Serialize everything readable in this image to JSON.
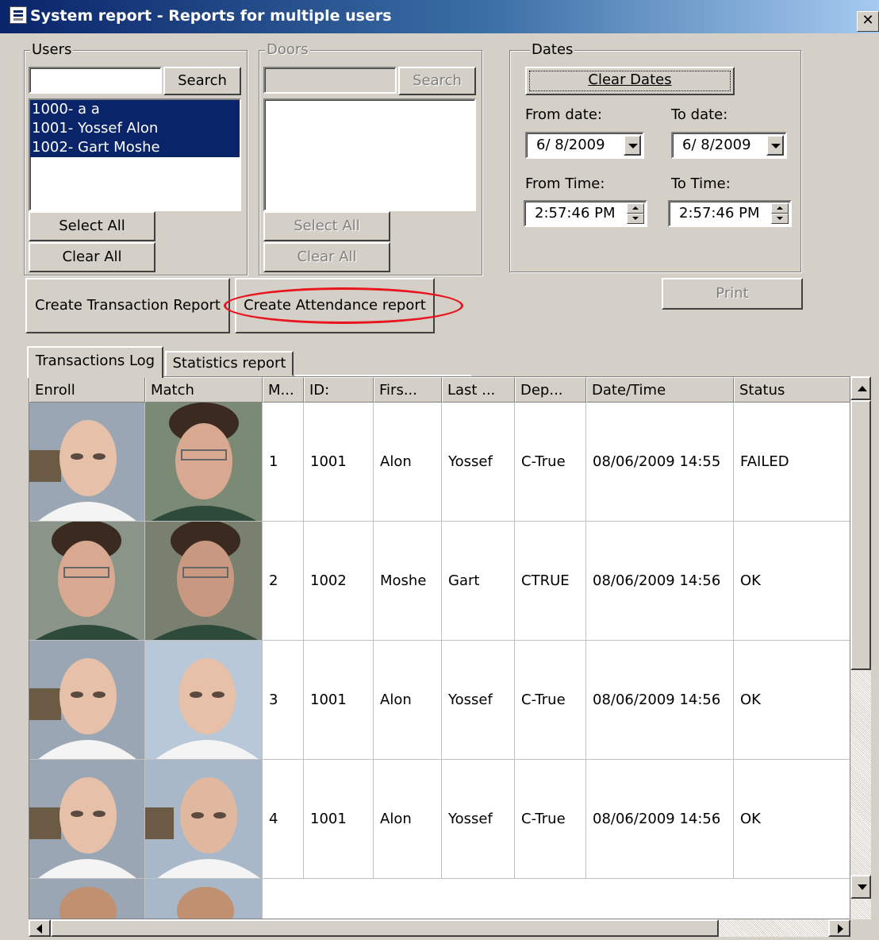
{
  "window": {
    "title": "System report - Reports for multiple users",
    "close_label": "✕"
  },
  "users": {
    "legend": "Users",
    "search_value": "",
    "search_label": "Search",
    "items": [
      "1000- a a",
      "1001- Yossef Alon",
      "1002- Gart Moshe"
    ],
    "select_all_label": "Select All",
    "clear_all_label": "Clear All"
  },
  "doors": {
    "legend": "Doors",
    "search_value": "",
    "search_label": "Search",
    "select_all_label": "Select All",
    "clear_all_label": "Clear All"
  },
  "dates": {
    "legend": "Dates",
    "clear_label": "Clear Dates",
    "from_date_label": "From date:",
    "to_date_label": "To date:",
    "from_date_value": "6/ 8/2009",
    "to_date_value": "6/ 8/2009",
    "from_time_label": "From Time:",
    "to_time_label": "To Time:",
    "from_time_value": "2:57:46 PM",
    "to_time_value": "2:57:46 PM"
  },
  "actions": {
    "transaction_label": "Create Transaction Report",
    "attendance_label": "Create Attendance report",
    "print_label": "Print"
  },
  "highlight_color": "#e8141e",
  "tabs": [
    "Transactions Log",
    "Statistics report"
  ],
  "grid": {
    "columns": [
      "Enroll",
      "Match",
      "M...",
      "ID:",
      "Firs...",
      "Last ...",
      "Dep...",
      "Date/Time",
      "Status"
    ],
    "rows": [
      {
        "m": "1",
        "id": "1001",
        "first": "Alon",
        "last": "Yossef",
        "dep": "C-True",
        "datetime": "08/06/2009 14:55",
        "status": "FAILED"
      },
      {
        "m": "2",
        "id": "1002",
        "first": "Moshe",
        "last": "Gart",
        "dep": "CTRUE",
        "datetime": "08/06/2009 14:56",
        "status": "OK"
      },
      {
        "m": "3",
        "id": "1001",
        "first": "Alon",
        "last": "Yossef",
        "dep": "C-True",
        "datetime": "08/06/2009 14:56",
        "status": "OK"
      },
      {
        "m": "4",
        "id": "1001",
        "first": "Alon",
        "last": "Yossef",
        "dep": "C-True",
        "datetime": "08/06/2009 14:56",
        "status": "OK"
      }
    ]
  }
}
